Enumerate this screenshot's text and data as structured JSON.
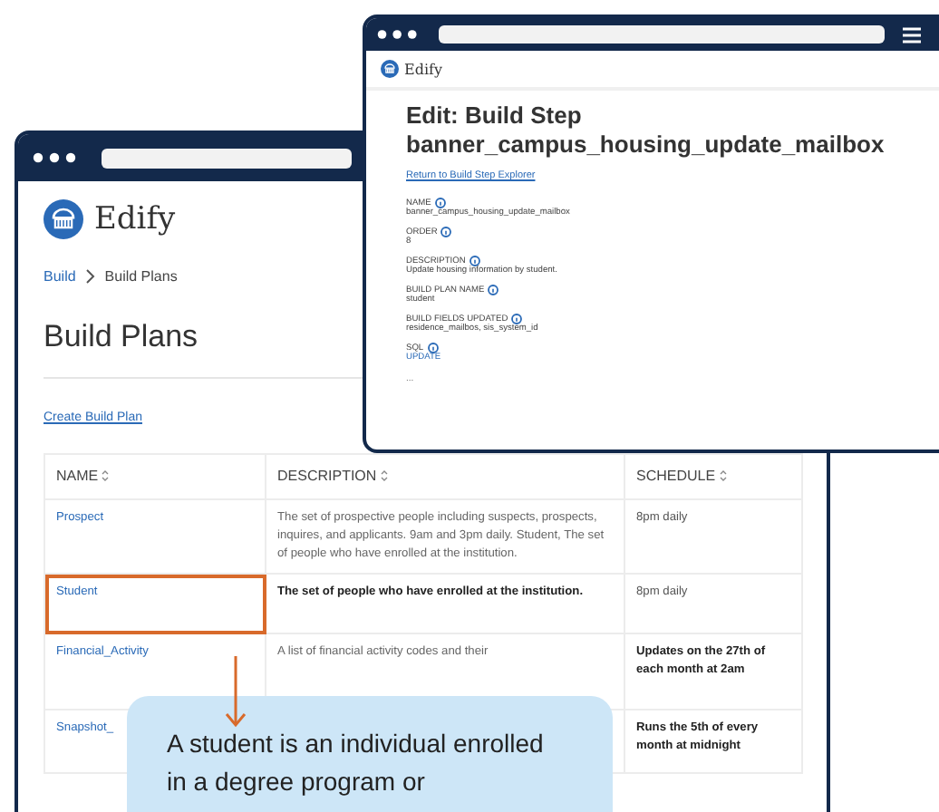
{
  "back_window": {
    "logo": "Edify",
    "breadcrumb": [
      {
        "label": "Build",
        "kind": "link"
      },
      {
        "label": "Build Plans",
        "kind": "current"
      }
    ],
    "heading": "Build Plans",
    "create_link": "Create Build Plan",
    "table": {
      "columns": [
        "NAME",
        "DESCRIPTION",
        "SCHEDULE"
      ],
      "rows": [
        {
          "name": "Prospect",
          "description": "The set of prospective people including suspects, prospects, inquires, and applicants. 9am and 3pm daily. Student, The set of people who have enrolled at the institution.",
          "schedule": "8pm daily",
          "highlighted": false
        },
        {
          "name": "Student",
          "description": "The set of people who have enrolled at the institution.",
          "schedule": "8pm daily",
          "highlighted": true
        },
        {
          "name": "Financial_Activity",
          "description": "A list of financial activity codes and their",
          "schedule": "Updates on the 27th of each month at 2am",
          "highlighted": false
        },
        {
          "name": "Snapshot_",
          "description": "",
          "schedule": "Runs the 5th of every month at midnight",
          "highlighted": false
        }
      ]
    }
  },
  "front_window": {
    "logo": "Edify",
    "title_line_1": "Edit: Build Step",
    "title_line_2": "banner_campus_housing_update_mailbox",
    "return_link": "Return to Build Step Explorer",
    "fields": [
      {
        "label": "NAME",
        "value": "banner_campus_housing_update_mailbox",
        "kind": "text"
      },
      {
        "label": "ORDER",
        "value": "8",
        "kind": "text"
      },
      {
        "label": "DESCRIPTION",
        "value": "Update housing information by student.",
        "kind": "text"
      },
      {
        "label": "BUILD PLAN NAME",
        "value": "student",
        "kind": "text"
      },
      {
        "label": "BUILD FIELDS UPDATED",
        "value": "residence_mailbos, sis_system_id",
        "kind": "text"
      },
      {
        "label": "SQL",
        "value": "UPDATE",
        "kind": "code"
      }
    ],
    "more": "..."
  },
  "callout": {
    "text": "A student is an individual enrolled in a degree program or"
  }
}
